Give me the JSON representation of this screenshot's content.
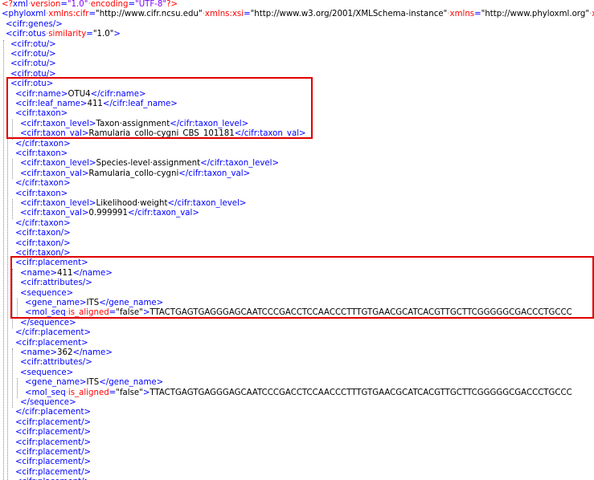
{
  "colors": {
    "tag": "#0000ff",
    "attribute": "#ff0000",
    "attribute_value": "#8000ff",
    "text": "#000000",
    "highlight": "#e00000"
  },
  "lines": [
    {
      "indent": 0,
      "parts": [
        [
          "pi",
          "<?"
        ],
        [
          "tag",
          "xml"
        ],
        [
          "dot",
          "·"
        ],
        [
          "attr",
          "version"
        ],
        [
          "eq",
          "="
        ],
        [
          "val",
          "\"1.0\""
        ],
        [
          "dot",
          "·"
        ],
        [
          "attr",
          "encoding"
        ],
        [
          "eq",
          "="
        ],
        [
          "val",
          "\"UTF-8\""
        ],
        [
          "pi",
          "?>"
        ]
      ]
    },
    {
      "indent": 0,
      "parts": [
        [
          "br",
          "<"
        ],
        [
          "tag",
          "phyloxml"
        ],
        [
          "dot",
          "·"
        ],
        [
          "attr",
          "xmlns:cifr"
        ],
        [
          "eq",
          "="
        ],
        [
          "text",
          "\"http://www.cifr.ncsu.edu\""
        ],
        [
          "dot",
          "·"
        ],
        [
          "attr",
          "xmlns:xsi"
        ],
        [
          "eq",
          "="
        ],
        [
          "text",
          "\"http://www.w3.org/2001/XMLSchema-instance\""
        ],
        [
          "dot",
          "·"
        ],
        [
          "attr",
          "xmlns"
        ],
        [
          "eq",
          "="
        ],
        [
          "text",
          "\"http://www.phyloxml.org\""
        ],
        [
          "dot",
          "·"
        ],
        [
          "attr",
          "x"
        ]
      ]
    },
    {
      "indent": 1,
      "parts": [
        [
          "br",
          "<"
        ],
        [
          "tag",
          "cifr:genes"
        ],
        [
          "br",
          "/>"
        ]
      ]
    },
    {
      "indent": 1,
      "parts": [
        [
          "br",
          "<"
        ],
        [
          "tag",
          "cifr:otus"
        ],
        [
          "dot",
          "·"
        ],
        [
          "attr",
          "similarity"
        ],
        [
          "eq",
          "="
        ],
        [
          "text",
          "\"1.0\""
        ],
        [
          "br",
          ">"
        ]
      ]
    },
    {
      "indent": 2,
      "parts": [
        [
          "br",
          "<"
        ],
        [
          "tag",
          "cifr:otu"
        ],
        [
          "br",
          "/>"
        ]
      ]
    },
    {
      "indent": 2,
      "parts": [
        [
          "br",
          "<"
        ],
        [
          "tag",
          "cifr:otu"
        ],
        [
          "br",
          "/>"
        ]
      ]
    },
    {
      "indent": 2,
      "parts": [
        [
          "br",
          "<"
        ],
        [
          "tag",
          "cifr:otu"
        ],
        [
          "br",
          "/>"
        ]
      ]
    },
    {
      "indent": 2,
      "parts": [
        [
          "br",
          "<"
        ],
        [
          "tag",
          "cifr:otu"
        ],
        [
          "br",
          "/>"
        ]
      ]
    },
    {
      "indent": 2,
      "parts": [
        [
          "br",
          "<"
        ],
        [
          "tag",
          "cifr:otu"
        ],
        [
          "br",
          ">"
        ]
      ]
    },
    {
      "indent": 3,
      "parts": [
        [
          "br",
          "<"
        ],
        [
          "tag",
          "cifr:name"
        ],
        [
          "br",
          ">"
        ],
        [
          "text",
          "OTU4"
        ],
        [
          "br",
          "</"
        ],
        [
          "tag",
          "cifr:name"
        ],
        [
          "br",
          ">"
        ]
      ]
    },
    {
      "indent": 3,
      "parts": [
        [
          "br",
          "<"
        ],
        [
          "tag",
          "cifr:leaf_name"
        ],
        [
          "br",
          ">"
        ],
        [
          "text",
          "411"
        ],
        [
          "br",
          "</"
        ],
        [
          "tag",
          "cifr:leaf_name"
        ],
        [
          "br",
          ">"
        ]
      ]
    },
    {
      "indent": 3,
      "parts": [
        [
          "br",
          "<"
        ],
        [
          "tag",
          "cifr:taxon"
        ],
        [
          "br",
          ">"
        ]
      ]
    },
    {
      "indent": 4,
      "parts": [
        [
          "br",
          "<"
        ],
        [
          "tag",
          "cifr:taxon_level"
        ],
        [
          "br",
          ">"
        ],
        [
          "text",
          "Taxon·assignment"
        ],
        [
          "br",
          "</"
        ],
        [
          "tag",
          "cifr:taxon_level"
        ],
        [
          "br",
          ">"
        ]
      ]
    },
    {
      "indent": 4,
      "parts": [
        [
          "br",
          "<"
        ],
        [
          "tag",
          "cifr:taxon_val"
        ],
        [
          "br",
          ">"
        ],
        [
          "text",
          "Ramularia_collo-cygni_CBS_101181"
        ],
        [
          "br",
          "</"
        ],
        [
          "tag",
          "cifr:taxon_val"
        ],
        [
          "br",
          ">"
        ]
      ]
    },
    {
      "indent": 3,
      "parts": [
        [
          "br",
          "</"
        ],
        [
          "tag",
          "cifr:taxon"
        ],
        [
          "br",
          ">"
        ]
      ]
    },
    {
      "indent": 3,
      "parts": [
        [
          "br",
          "<"
        ],
        [
          "tag",
          "cifr:taxon"
        ],
        [
          "br",
          ">"
        ]
      ]
    },
    {
      "indent": 4,
      "parts": [
        [
          "br",
          "<"
        ],
        [
          "tag",
          "cifr:taxon_level"
        ],
        [
          "br",
          ">"
        ],
        [
          "text",
          "Species-level·assignment"
        ],
        [
          "br",
          "</"
        ],
        [
          "tag",
          "cifr:taxon_level"
        ],
        [
          "br",
          ">"
        ]
      ]
    },
    {
      "indent": 4,
      "parts": [
        [
          "br",
          "<"
        ],
        [
          "tag",
          "cifr:taxon_val"
        ],
        [
          "br",
          ">"
        ],
        [
          "text",
          "Ramularia_collo-cygni"
        ],
        [
          "br",
          "</"
        ],
        [
          "tag",
          "cifr:taxon_val"
        ],
        [
          "br",
          ">"
        ]
      ]
    },
    {
      "indent": 3,
      "parts": [
        [
          "br",
          "</"
        ],
        [
          "tag",
          "cifr:taxon"
        ],
        [
          "br",
          ">"
        ]
      ]
    },
    {
      "indent": 3,
      "parts": [
        [
          "br",
          "<"
        ],
        [
          "tag",
          "cifr:taxon"
        ],
        [
          "br",
          ">"
        ]
      ]
    },
    {
      "indent": 4,
      "parts": [
        [
          "br",
          "<"
        ],
        [
          "tag",
          "cifr:taxon_level"
        ],
        [
          "br",
          ">"
        ],
        [
          "text",
          "Likelihood·weight"
        ],
        [
          "br",
          "</"
        ],
        [
          "tag",
          "cifr:taxon_level"
        ],
        [
          "br",
          ">"
        ]
      ]
    },
    {
      "indent": 4,
      "parts": [
        [
          "br",
          "<"
        ],
        [
          "tag",
          "cifr:taxon_val"
        ],
        [
          "br",
          ">"
        ],
        [
          "text",
          "0.999991"
        ],
        [
          "br",
          "</"
        ],
        [
          "tag",
          "cifr:taxon_val"
        ],
        [
          "br",
          ">"
        ]
      ]
    },
    {
      "indent": 3,
      "parts": [
        [
          "br",
          "</"
        ],
        [
          "tag",
          "cifr:taxon"
        ],
        [
          "br",
          ">"
        ]
      ]
    },
    {
      "indent": 3,
      "parts": [
        [
          "br",
          "<"
        ],
        [
          "tag",
          "cifr:taxon"
        ],
        [
          "br",
          "/>"
        ]
      ]
    },
    {
      "indent": 3,
      "parts": [
        [
          "br",
          "<"
        ],
        [
          "tag",
          "cifr:taxon"
        ],
        [
          "br",
          "/>"
        ]
      ]
    },
    {
      "indent": 3,
      "parts": [
        [
          "br",
          "<"
        ],
        [
          "tag",
          "cifr:taxon"
        ],
        [
          "br",
          "/>"
        ]
      ]
    },
    {
      "indent": 3,
      "parts": [
        [
          "br",
          "<"
        ],
        [
          "tag",
          "cifr:placement"
        ],
        [
          "br",
          ">"
        ]
      ]
    },
    {
      "indent": 4,
      "parts": [
        [
          "br",
          "<"
        ],
        [
          "tag",
          "name"
        ],
        [
          "br",
          ">"
        ],
        [
          "text",
          "411"
        ],
        [
          "br",
          "</"
        ],
        [
          "tag",
          "name"
        ],
        [
          "br",
          ">"
        ]
      ]
    },
    {
      "indent": 4,
      "parts": [
        [
          "br",
          "<"
        ],
        [
          "tag",
          "cifr:attributes"
        ],
        [
          "br",
          "/>"
        ]
      ]
    },
    {
      "indent": 4,
      "parts": [
        [
          "br",
          "<"
        ],
        [
          "tag",
          "sequence"
        ],
        [
          "br",
          ">"
        ]
      ]
    },
    {
      "indent": 5,
      "parts": [
        [
          "br",
          "<"
        ],
        [
          "tag",
          "gene_name"
        ],
        [
          "br",
          ">"
        ],
        [
          "text",
          "ITS"
        ],
        [
          "br",
          "</"
        ],
        [
          "tag",
          "gene_name"
        ],
        [
          "br",
          ">"
        ]
      ]
    },
    {
      "indent": 5,
      "parts": [
        [
          "br",
          "<"
        ],
        [
          "tag",
          "mol_seq"
        ],
        [
          "dot",
          "·"
        ],
        [
          "attr",
          "is_aligned"
        ],
        [
          "eq",
          "="
        ],
        [
          "text",
          "\"false\""
        ],
        [
          "br",
          ">"
        ],
        [
          "text",
          "TTACTGAGTGAGGGAGCAATCCCGACCTCCAACCCTTTGTGAACGCATCACGTTGCTTCGGGGGCGACCCTGCCC"
        ]
      ]
    },
    {
      "indent": 4,
      "parts": [
        [
          "br",
          "</"
        ],
        [
          "tag",
          "sequence"
        ],
        [
          "br",
          ">"
        ]
      ]
    },
    {
      "indent": 3,
      "parts": [
        [
          "br",
          "</"
        ],
        [
          "tag",
          "cifr:placement"
        ],
        [
          "br",
          ">"
        ]
      ]
    },
    {
      "indent": 3,
      "parts": [
        [
          "br",
          "<"
        ],
        [
          "tag",
          "cifr:placement"
        ],
        [
          "br",
          ">"
        ]
      ]
    },
    {
      "indent": 4,
      "parts": [
        [
          "br",
          "<"
        ],
        [
          "tag",
          "name"
        ],
        [
          "br",
          ">"
        ],
        [
          "text",
          "362"
        ],
        [
          "br",
          "</"
        ],
        [
          "tag",
          "name"
        ],
        [
          "br",
          ">"
        ]
      ]
    },
    {
      "indent": 4,
      "parts": [
        [
          "br",
          "<"
        ],
        [
          "tag",
          "cifr:attributes"
        ],
        [
          "br",
          "/>"
        ]
      ]
    },
    {
      "indent": 4,
      "parts": [
        [
          "br",
          "<"
        ],
        [
          "tag",
          "sequence"
        ],
        [
          "br",
          ">"
        ]
      ]
    },
    {
      "indent": 5,
      "parts": [
        [
          "br",
          "<"
        ],
        [
          "tag",
          "gene_name"
        ],
        [
          "br",
          ">"
        ],
        [
          "text",
          "ITS"
        ],
        [
          "br",
          "</"
        ],
        [
          "tag",
          "gene_name"
        ],
        [
          "br",
          ">"
        ]
      ]
    },
    {
      "indent": 5,
      "parts": [
        [
          "br",
          "<"
        ],
        [
          "tag",
          "mol_seq"
        ],
        [
          "dot",
          "·"
        ],
        [
          "attr",
          "is_aligned"
        ],
        [
          "eq",
          "="
        ],
        [
          "text",
          "\"false\""
        ],
        [
          "br",
          ">"
        ],
        [
          "text",
          "TTACTGAGTGAGGGAGCAATCCCGACCTCCAACCCTTTGTGAACGCATCACGTTGCTTCGGGGGCGACCCTGCCC"
        ]
      ]
    },
    {
      "indent": 4,
      "parts": [
        [
          "br",
          "</"
        ],
        [
          "tag",
          "sequence"
        ],
        [
          "br",
          ">"
        ]
      ]
    },
    {
      "indent": 3,
      "parts": [
        [
          "br",
          "</"
        ],
        [
          "tag",
          "cifr:placement"
        ],
        [
          "br",
          ">"
        ]
      ]
    },
    {
      "indent": 3,
      "parts": [
        [
          "br",
          "<"
        ],
        [
          "tag",
          "cifr:placement"
        ],
        [
          "br",
          "/>"
        ]
      ]
    },
    {
      "indent": 3,
      "parts": [
        [
          "br",
          "<"
        ],
        [
          "tag",
          "cifr:placement"
        ],
        [
          "br",
          "/>"
        ]
      ]
    },
    {
      "indent": 3,
      "parts": [
        [
          "br",
          "<"
        ],
        [
          "tag",
          "cifr:placement"
        ],
        [
          "br",
          "/>"
        ]
      ]
    },
    {
      "indent": 3,
      "parts": [
        [
          "br",
          "<"
        ],
        [
          "tag",
          "cifr:placement"
        ],
        [
          "br",
          "/>"
        ]
      ]
    },
    {
      "indent": 3,
      "parts": [
        [
          "br",
          "<"
        ],
        [
          "tag",
          "cifr:placement"
        ],
        [
          "br",
          "/>"
        ]
      ]
    },
    {
      "indent": 3,
      "parts": [
        [
          "br",
          "<"
        ],
        [
          "tag",
          "cifr:placement"
        ],
        [
          "br",
          "/>"
        ]
      ]
    },
    {
      "indent": 3,
      "parts": [
        [
          "br",
          "<"
        ],
        [
          "tag",
          "cifr:placement"
        ],
        [
          "br",
          "/>"
        ]
      ]
    }
  ]
}
